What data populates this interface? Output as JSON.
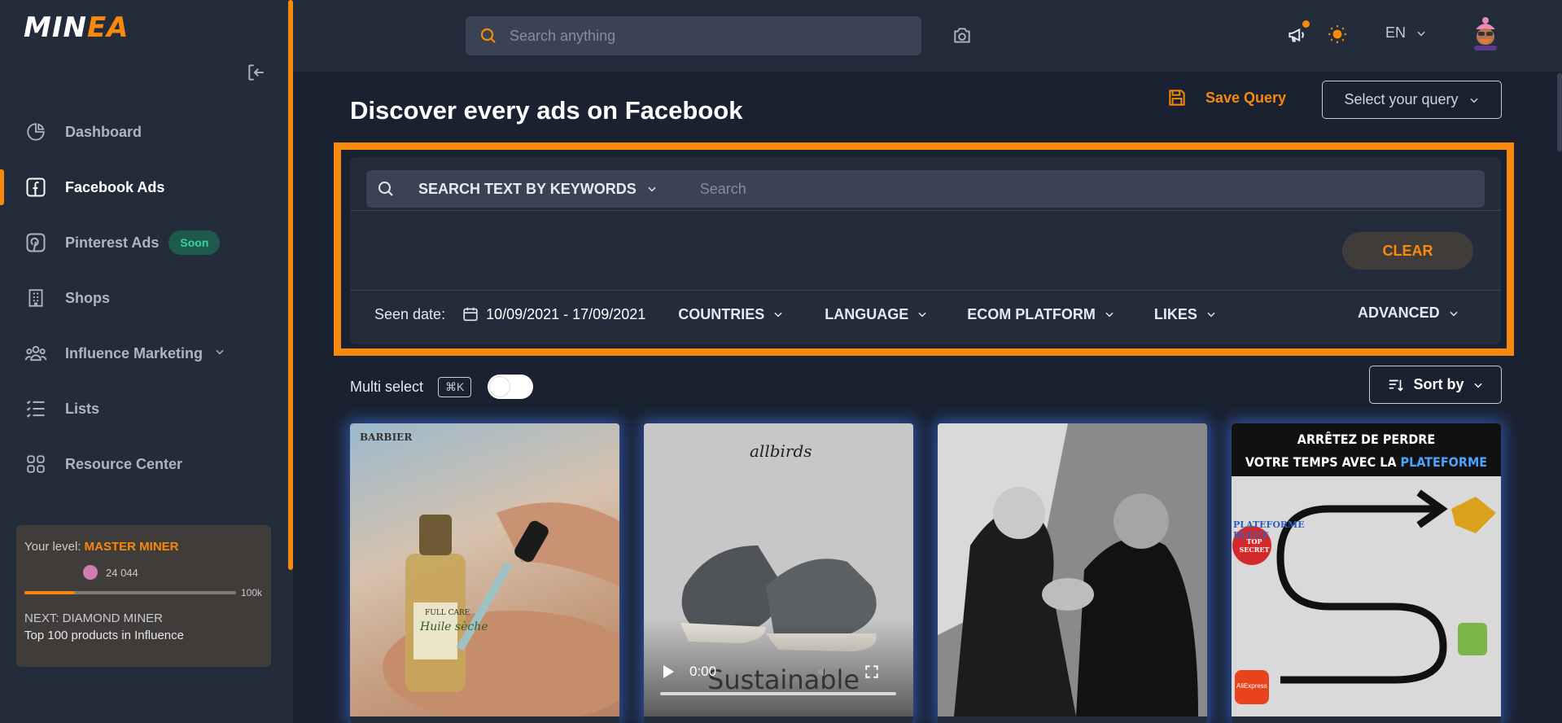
{
  "app": {
    "logo_main": "MIN",
    "logo_accent": "EA"
  },
  "sidebar": {
    "items": [
      {
        "label": "Dashboard",
        "icon": "pie-chart-icon"
      },
      {
        "label": "Facebook Ads",
        "icon": "facebook-icon",
        "active": true
      },
      {
        "label": "Pinterest Ads",
        "icon": "pinterest-icon",
        "badge": "Soon"
      },
      {
        "label": "Shops",
        "icon": "building-icon"
      },
      {
        "label": "Influence Marketing",
        "icon": "people-icon",
        "expandable": true
      },
      {
        "label": "Lists",
        "icon": "list-icon"
      },
      {
        "label": "Resource Center",
        "icon": "grid-icon"
      }
    ],
    "level": {
      "label": "Your level:",
      "value": "MASTER MINER",
      "points": "24 044",
      "progress_fraction": 0.24,
      "max": "100k",
      "next_label": "NEXT: DIAMOND MINER",
      "next_desc": "Top 100 products in Influence"
    }
  },
  "topbar": {
    "search_placeholder": "Search anything",
    "language": "EN"
  },
  "main": {
    "title": "Discover every ads on Facebook",
    "save_query": "Save Query",
    "select_query": "Select your query",
    "search_type": "SEARCH TEXT BY KEYWORDS",
    "search_placeholder": "Search",
    "clear": "CLEAR",
    "seen_date_label": "Seen date:",
    "date_range": "10/09/2021 - 17/09/2021",
    "filters": [
      "COUNTRIES",
      "LANGUAGE",
      "ECOM PLATFORM",
      "LIKES"
    ],
    "advanced": "ADVANCED",
    "multi_select": "Multi select",
    "shortcut": "⌘K",
    "sort_by": "Sort by"
  },
  "cards": [
    {
      "brand": "BARBIER",
      "product": "Huile sèche",
      "sub": "FULL CARE"
    },
    {
      "brand": "allbirds",
      "time": "0:00",
      "overlay": "Sustainable"
    },
    {
      "brand": ""
    },
    {
      "headline_1": "ARRÊTEZ DE PERDRE",
      "headline_2a": "VOTRE TEMPS AVEC LA",
      "headline_2b": "PLATEFORME BLEUE",
      "strike_text": "PLATEFORME BLEUE",
      "stamp": "TOP SECRET",
      "logo": "AliExpress"
    }
  ],
  "colors": {
    "accent": "#f7890d",
    "bg": "#1a2231",
    "panel": "#232c3b",
    "soon_badge": "#35d39a"
  }
}
